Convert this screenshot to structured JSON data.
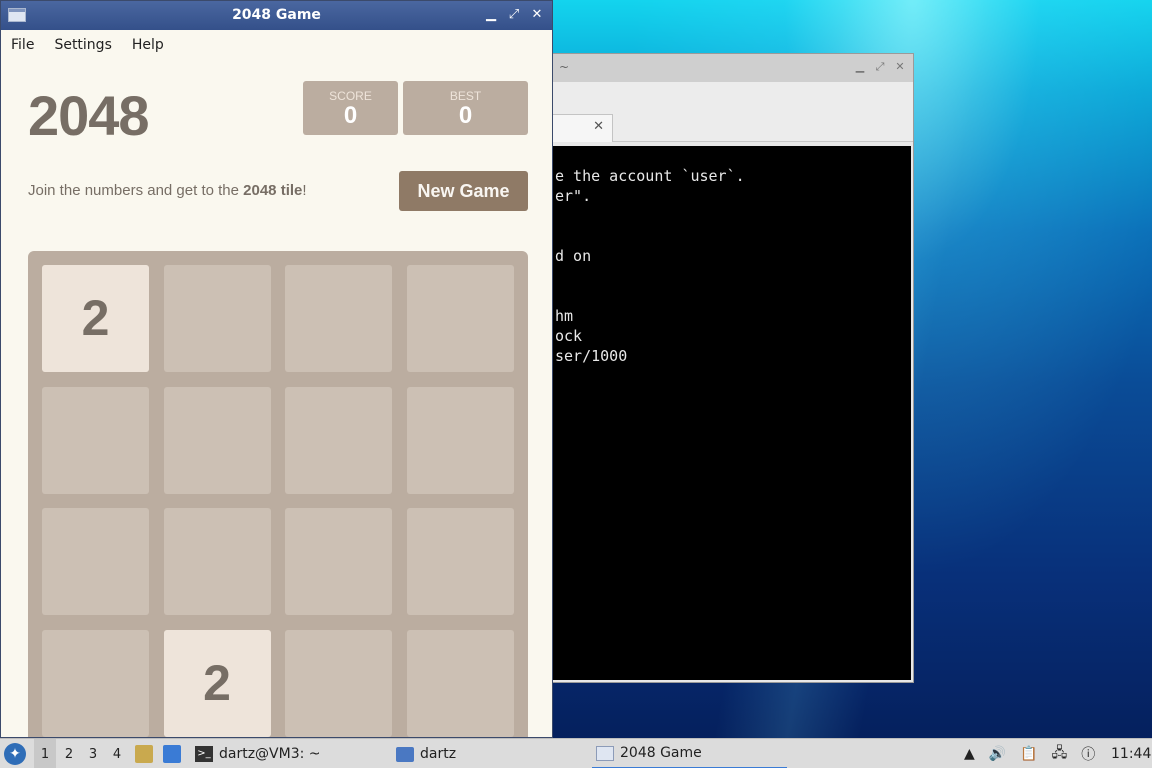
{
  "game_window": {
    "title": "2048 Game",
    "controls": [
      "▁",
      "⤢",
      "✕"
    ],
    "menu": [
      "File",
      "Settings",
      "Help"
    ],
    "heading": "2048",
    "score": {
      "label": "SCORE",
      "value": "0"
    },
    "best": {
      "label": "BEST",
      "value": "0"
    },
    "intro_prefix": "Join the numbers and get to the ",
    "intro_bold": "2048 tile",
    "intro_suffix": "!",
    "new_game_label": "New Game",
    "board": [
      [
        "2",
        "",
        "",
        ""
      ],
      [
        "",
        "",
        "",
        ""
      ],
      [
        "",
        "",
        "",
        ""
      ],
      [
        "",
        "2",
        "",
        ""
      ]
    ]
  },
  "terminal_window": {
    "title": "~",
    "tab_close": "✕",
    "lines": [
      "e the account `user`.",
      "er\".",
      "",
      "",
      "d on",
      "",
      "",
      "hm",
      "ock",
      "ser/1000"
    ]
  },
  "taskbar": {
    "workspaces": [
      "1",
      "2",
      "3",
      "4"
    ],
    "tasks": [
      {
        "label": "dartz@VM3: ~",
        "icon": "terminal-icon"
      },
      {
        "label": "dartz",
        "icon": "folder-icon"
      },
      {
        "label": "2048 Game",
        "icon": "window-icon"
      }
    ],
    "clock": "11:44"
  }
}
